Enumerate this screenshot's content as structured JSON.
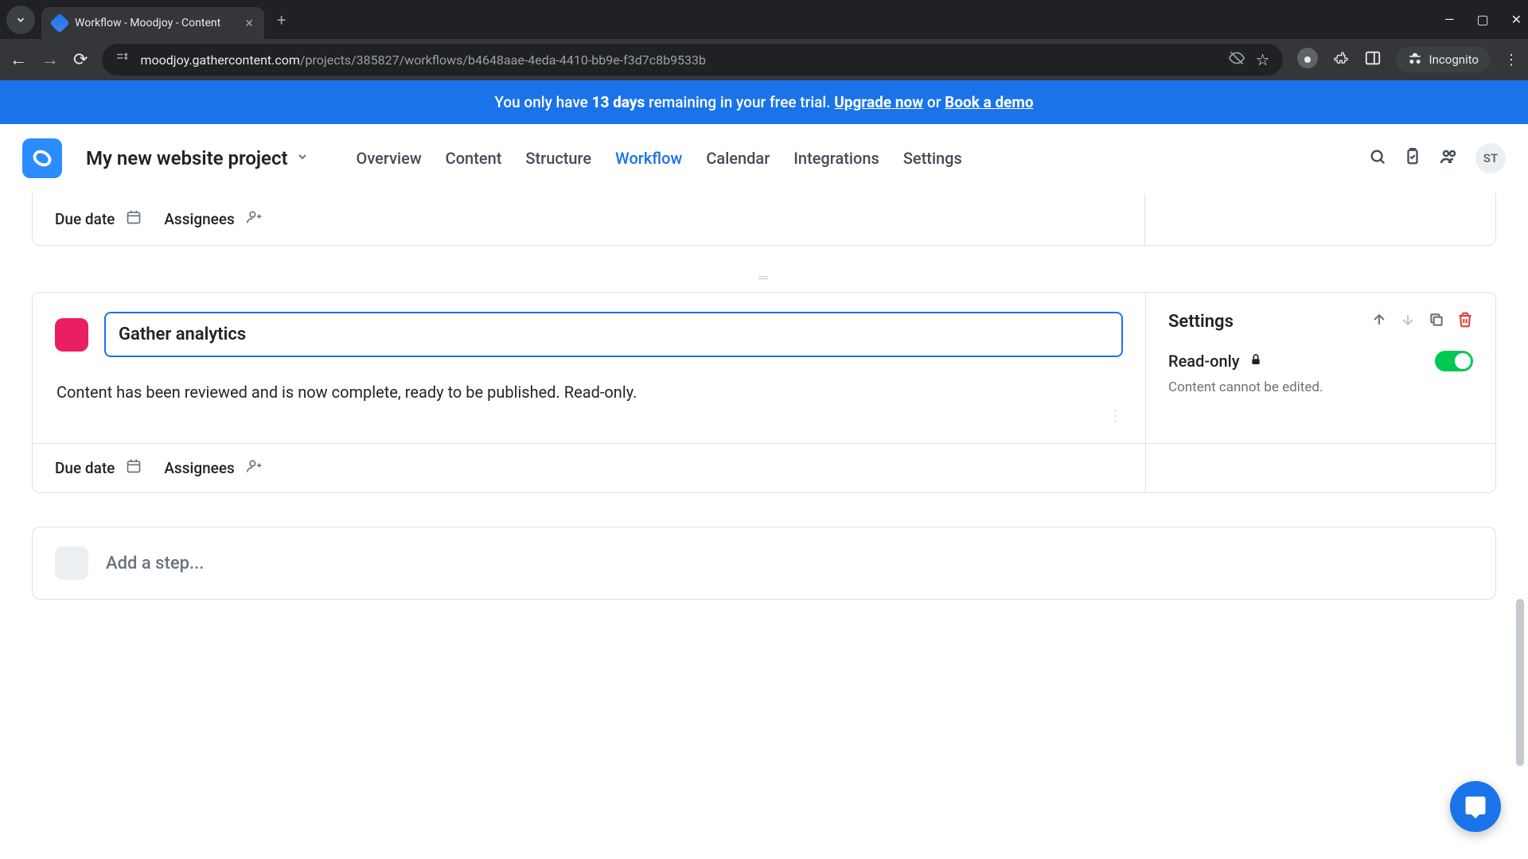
{
  "browser": {
    "tab_title": "Workflow - Moodjoy - Content",
    "url_domain": "moodjoy.gathercontent.com",
    "url_path": "/projects/385827/workflows/b4648aae-4eda-4410-bb9e-f3d7c8b9533b",
    "incognito_label": "Incognito"
  },
  "banner": {
    "prefix": "You only have ",
    "days": "13 days",
    "mid": " remaining in your free trial. ",
    "upgrade": "Upgrade now",
    "or": " or ",
    "book": "Book a demo"
  },
  "header": {
    "project": "My new website project",
    "tabs": [
      "Overview",
      "Content",
      "Structure",
      "Workflow",
      "Calendar",
      "Integrations",
      "Settings"
    ],
    "active_tab": "Workflow",
    "avatar": "ST"
  },
  "workflow": {
    "due_date_label": "Due date",
    "assignees_label": "Assignees",
    "step_title": "Gather analytics",
    "step_description": "Content has been reviewed and is now complete, ready to be published. Read-only.",
    "settings_label": "Settings",
    "readonly_label": "Read-only",
    "readonly_help": "Content cannot be edited.",
    "readonly_on": true,
    "add_step_placeholder": "Add a step...",
    "color": "#e91e63"
  }
}
